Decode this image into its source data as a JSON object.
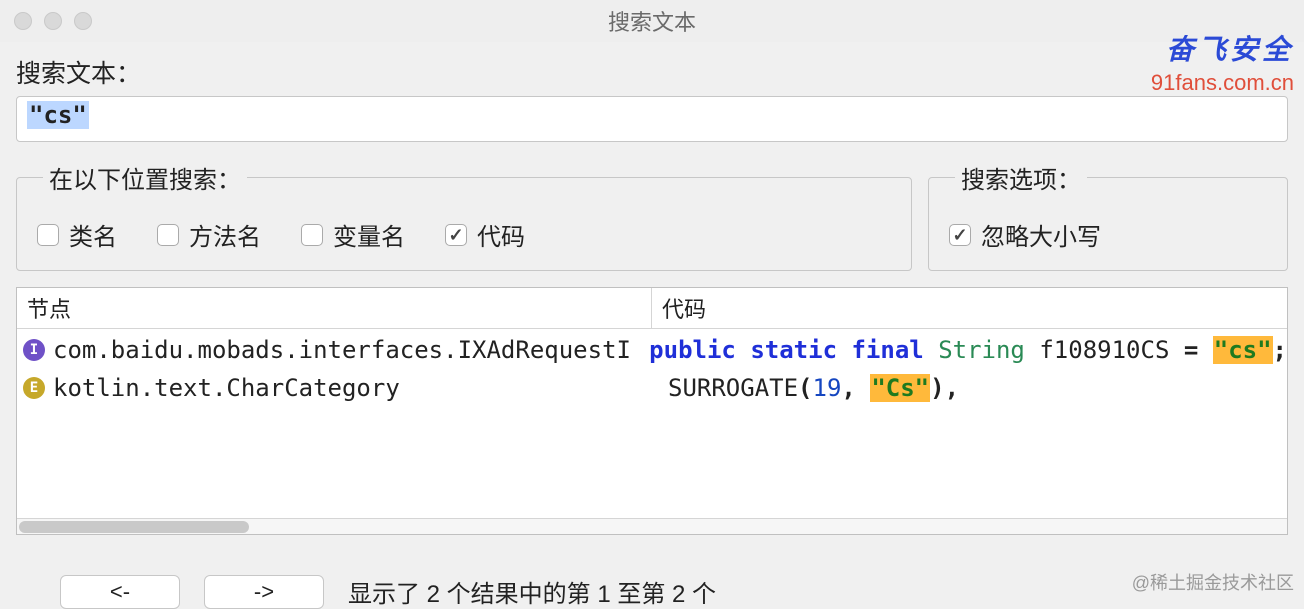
{
  "window": {
    "title": "搜索文本"
  },
  "watermark": {
    "line1": "奋飞安全",
    "line2": "91fans.com.cn"
  },
  "labels": {
    "search": "搜索文本："
  },
  "search": {
    "value": "\"cs\""
  },
  "groups": {
    "locations": {
      "legend": "在以下位置搜索：",
      "classname": {
        "label": "类名",
        "checked": false
      },
      "method": {
        "label": "方法名",
        "checked": false
      },
      "variable": {
        "label": "变量名",
        "checked": false
      },
      "code": {
        "label": "代码",
        "checked": true
      }
    },
    "options": {
      "legend": "搜索选项：",
      "ignore_case": {
        "label": "忽略大小写",
        "checked": true
      }
    }
  },
  "columns": {
    "node": "节点",
    "code": "代码"
  },
  "results": [
    {
      "icon": "I",
      "node": "com.baidu.mobads.interfaces.IXAdRequestI...",
      "code": {
        "tokens": [
          {
            "t": "kw",
            "v": "public"
          },
          {
            "t": "sp",
            "v": " "
          },
          {
            "t": "kw",
            "v": "static"
          },
          {
            "t": "sp",
            "v": " "
          },
          {
            "t": "kw",
            "v": "final"
          },
          {
            "t": "sp",
            "v": " "
          },
          {
            "t": "ty",
            "v": "String"
          },
          {
            "t": "sp",
            "v": " "
          },
          {
            "t": "id",
            "v": "f108910CS"
          },
          {
            "t": "sp",
            "v": " "
          },
          {
            "t": "pun",
            "v": "="
          },
          {
            "t": "sp",
            "v": " "
          },
          {
            "t": "strhl",
            "v": "\"cs\""
          },
          {
            "t": "pun",
            "v": ";"
          }
        ]
      }
    },
    {
      "icon": "E",
      "node": "kotlin.text.CharCategory",
      "code": {
        "tokens": [
          {
            "t": "id",
            "v": "SURROGATE"
          },
          {
            "t": "pun",
            "v": "("
          },
          {
            "t": "num",
            "v": "19"
          },
          {
            "t": "pun",
            "v": ","
          },
          {
            "t": "sp",
            "v": " "
          },
          {
            "t": "strhl",
            "v": "\"Cs\""
          },
          {
            "t": "pun",
            "v": ")"
          },
          {
            "t": "pun",
            "v": ","
          }
        ]
      }
    }
  ],
  "nav": {
    "prev": "<-",
    "next": "->"
  },
  "status": "显示了 2 个结果中的第 1 至第 2 个",
  "credit": "@稀土掘金技术社区"
}
